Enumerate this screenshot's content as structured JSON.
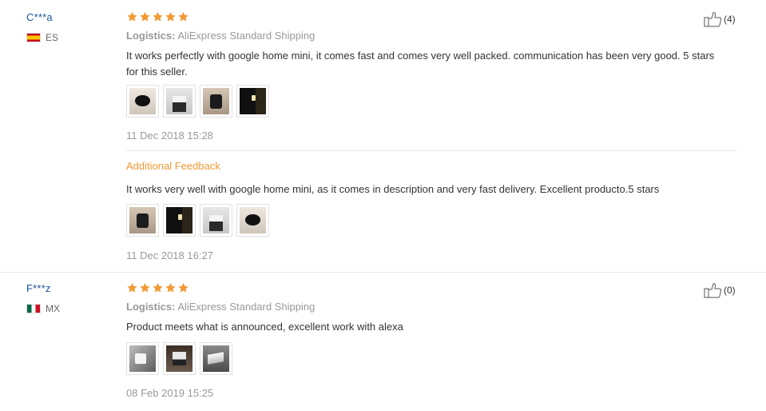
{
  "colors": {
    "star": "#f29a34",
    "username": "#1a5599",
    "feedback_title": "#f29a34"
  },
  "reviews": [
    {
      "user": "C***a",
      "country_code": "ES",
      "flag": "flag-es",
      "rating": 5,
      "helpful_count": "(4)",
      "logistics_label": "Logistics:",
      "logistics_value": "AliExpress Standard Shipping",
      "text": "It works perfectly with google home mini, it comes fast and comes very well packed. communication has been very good. 5 stars for this seller.",
      "images": [
        "review-photo",
        "review-photo",
        "review-photo",
        "review-photo"
      ],
      "date": "11 Dec 2018 15:28",
      "additional_feedback": {
        "title": "Additional Feedback",
        "text": "It works very well with google home mini, as it comes in description and very fast delivery. Excellent producto.5 stars",
        "images": [
          "review-photo",
          "review-photo",
          "review-photo",
          "review-photo"
        ],
        "date": "11 Dec 2018 16:27"
      }
    },
    {
      "user": "F***z",
      "country_code": "MX",
      "flag": "flag-mx",
      "rating": 5,
      "helpful_count": "(0)",
      "logistics_label": "Logistics:",
      "logistics_value": "AliExpress Standard Shipping",
      "text": "Product meets what is announced, excellent work with alexa",
      "images": [
        "review-photo",
        "review-photo",
        "review-photo"
      ],
      "date": "08 Feb 2019 15:25"
    }
  ],
  "icons": {
    "star": "star-icon",
    "helpful": "thumbs-up-icon"
  }
}
